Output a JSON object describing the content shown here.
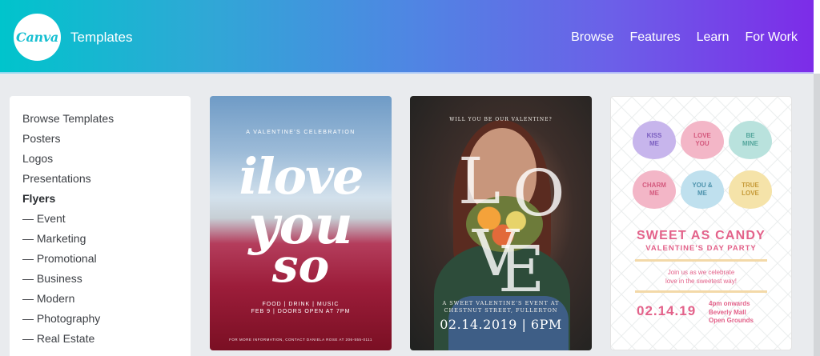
{
  "header": {
    "logo_text": "Canva",
    "brand_title": "Templates",
    "nav": [
      "Browse",
      "Features",
      "Learn",
      "For Work"
    ],
    "gradient": [
      "#00c4cc",
      "#7d2ae8"
    ]
  },
  "sidebar": {
    "items": [
      {
        "label": "Browse Templates"
      },
      {
        "label": "Posters"
      },
      {
        "label": "Logos"
      },
      {
        "label": "Presentations"
      },
      {
        "label": "Flyers",
        "active": true
      },
      {
        "label": "— Event"
      },
      {
        "label": "— Marketing"
      },
      {
        "label": "— Promotional"
      },
      {
        "label": "— Business"
      },
      {
        "label": "— Modern"
      },
      {
        "label": "— Photography"
      },
      {
        "label": "— Real Estate"
      }
    ]
  },
  "cards": [
    {
      "subtitle": "A VALENTINE'S CELEBRATION",
      "line1": "ilove",
      "line2": "you",
      "line3": "so",
      "footer1": "FOOD | DRINK | MUSIC",
      "footer2": "FEB 9 | DOORS OPEN AT 7PM",
      "footer3": "FOR MORE INFORMATION, CONTACT DANIELA ROSE AT 206-555-0111"
    },
    {
      "subtitle": "WILL YOU BE OUR VALENTINE?",
      "letters": [
        "L",
        "O",
        "V",
        "E"
      ],
      "footer1": "A SWEET VALENTINE'S EVENT AT",
      "footer2": "CHESTNUT STREET, FULLERTON",
      "date": "02.14.2019 | 6PM"
    },
    {
      "hearts": [
        {
          "line1": "KISS",
          "line2": "ME"
        },
        {
          "line1": "LOVE",
          "line2": "YOU"
        },
        {
          "line1": "BE",
          "line2": "MINE"
        },
        {
          "line1": "CHARM",
          "line2": "ME"
        },
        {
          "line1": "YOU &",
          "line2": "ME"
        },
        {
          "line1": "TRUE",
          "line2": "LOVE"
        }
      ],
      "title": "SWEET AS CANDY",
      "subtitle": "VALENTINE'S DAY PARTY",
      "join1": "Join us as we celebrate",
      "join2": "love in the sweetest way!",
      "date": "02.14.19",
      "info1": "4pm onwards",
      "info2": "Beverly Mall",
      "info3": "Open Grounds"
    }
  ]
}
